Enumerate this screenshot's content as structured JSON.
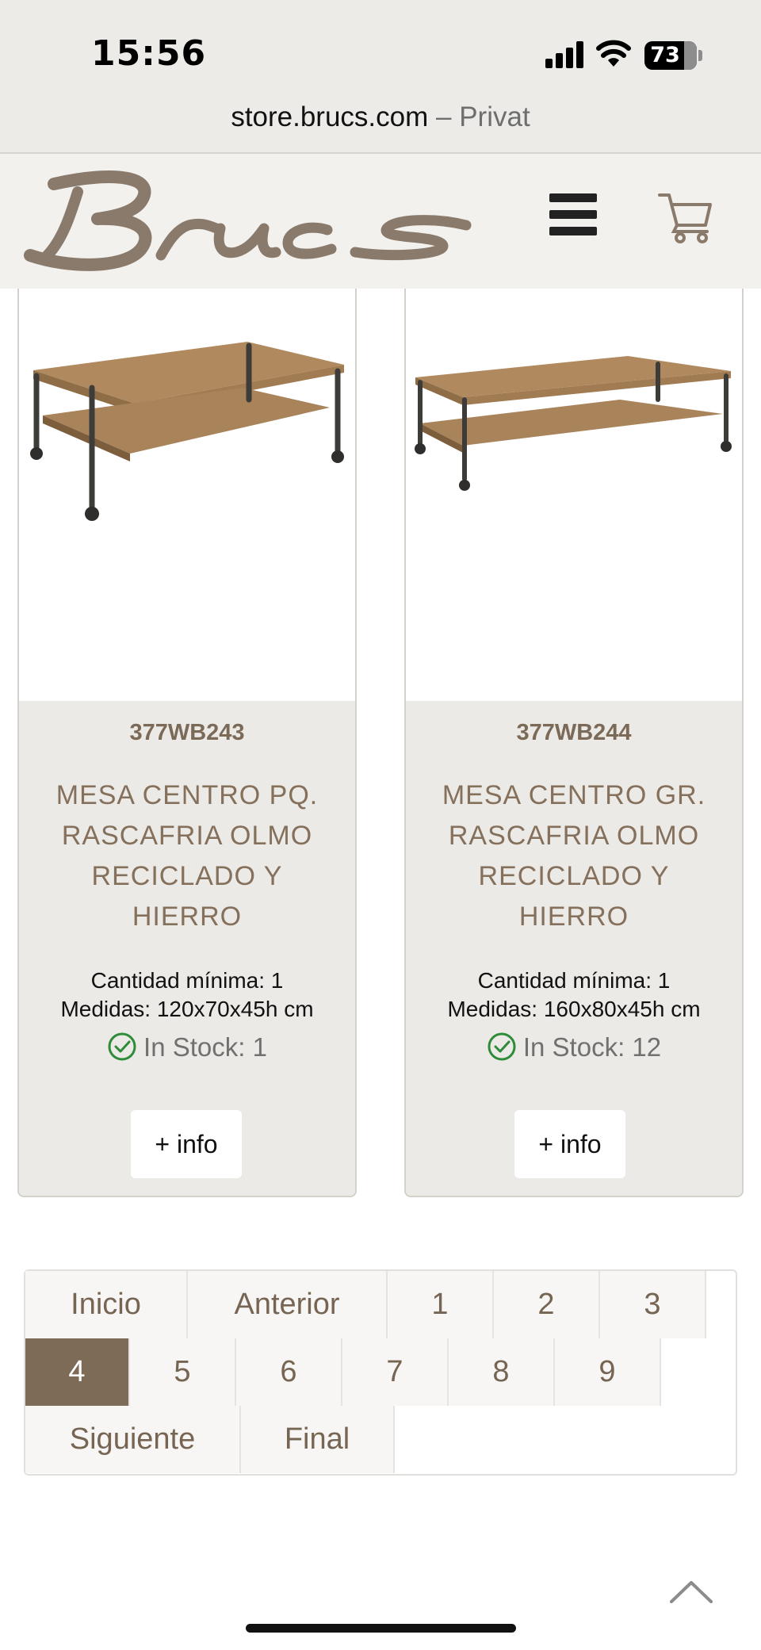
{
  "status_bar": {
    "time": "15:56",
    "battery": "73"
  },
  "browser": {
    "domain": "store.brucs.com",
    "separator": " – ",
    "mode": "Privat"
  },
  "header": {
    "logo_alt": "Brucs",
    "menu_icon": "hamburger-icon",
    "cart_icon": "cart-icon"
  },
  "products": [
    {
      "ref": "377WB243",
      "name": "MESA CENTRO PQ. RASCAFRIA OLMO RECICLADO Y HIERRO",
      "min_qty": "Cantidad mínima: 1",
      "dims": "Medidas: 120x70x45h cm",
      "stock": "In Stock: 1",
      "button": "+ info"
    },
    {
      "ref": "377WB244",
      "name": "MESA CENTRO GR. RASCAFRIA OLMO RECICLADO Y HIERRO",
      "min_qty": "Cantidad mínima: 1",
      "dims": "Medidas: 160x80x45h cm",
      "stock": "In Stock: 12",
      "button": "+ info"
    }
  ],
  "pagination": {
    "first": "Inicio",
    "prev": "Anterior",
    "pages": [
      "1",
      "2",
      "3",
      "4",
      "5",
      "6",
      "7",
      "8",
      "9"
    ],
    "current": "4",
    "next": "Siguiente",
    "last": "Final"
  },
  "colors": {
    "brand": "#7d6a57",
    "stock_ok": "#2e8b3a",
    "header_bg": "#f2f1ee"
  }
}
